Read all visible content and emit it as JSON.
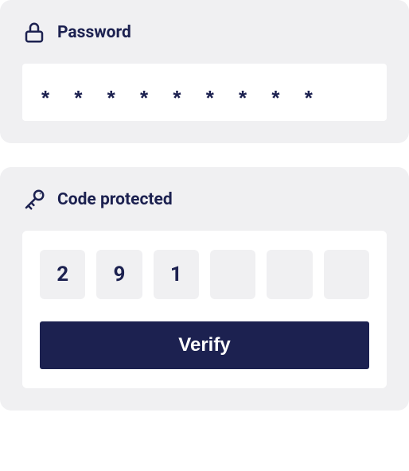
{
  "password": {
    "label": "Password",
    "value": "* * * * * * * * *"
  },
  "code": {
    "label": "Code protected",
    "cells": [
      "2",
      "9",
      "1",
      "",
      "",
      ""
    ],
    "verify_label": "Verify"
  },
  "colors": {
    "primary": "#1c2150"
  }
}
